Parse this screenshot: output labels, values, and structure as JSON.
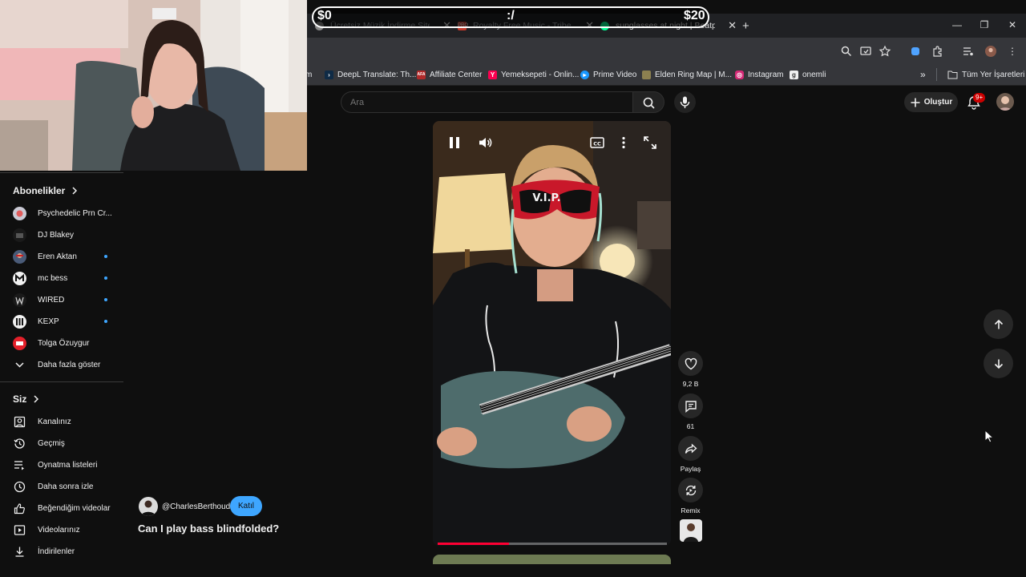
{
  "overlay": {
    "left": "$0",
    "center": ":/",
    "right": "$20"
  },
  "browser": {
    "tabs": [
      {
        "title": "Ücretsiz Müzik İndirme Siteleri",
        "favicon": "music-icon"
      },
      {
        "title": "Royalty Free Music - Tribe of N",
        "favicon": "pro-icon"
      },
      {
        "title": "sunglasses at night | Beatport",
        "favicon": "beatport-icon"
      }
    ],
    "new_tab": "+",
    "bookmarks": [
      {
        "label": "m"
      },
      {
        "label": "DeepL Translate: Th...",
        "icon": "deepl-icon"
      },
      {
        "label": "Affiliate Center",
        "icon": "affiliate-icon"
      },
      {
        "label": "Yemeksepeti - Onlin...",
        "icon": "yemeksepeti-icon"
      },
      {
        "label": "Prime Video",
        "icon": "prime-icon"
      },
      {
        "label": "Elden Ring Map | M...",
        "icon": "map-icon"
      },
      {
        "label": "Instagram",
        "icon": "instagram-icon"
      },
      {
        "label": "onemli",
        "icon": "folder-g-icon"
      }
    ],
    "all_bookmarks": "Tüm Yer İşaretleri"
  },
  "search": {
    "placeholder": "Ara"
  },
  "header": {
    "create_label": "Oluştur",
    "notif_badge": "9+"
  },
  "sidebar": {
    "subscriptions_title": "Abonelikler",
    "subscriptions": [
      {
        "name": "Psychedelic Prn Cr...",
        "color": "#c9c9d4",
        "new": false
      },
      {
        "name": "DJ Blakey",
        "color": "#1a1a1a",
        "new": false
      },
      {
        "name": "Eren Aktan",
        "color": "#4a5b78",
        "new": true
      },
      {
        "name": "mc bess",
        "color": "#f1f1f1",
        "new": true
      },
      {
        "name": "WIRED",
        "color": "#1a1a1a",
        "new": true
      },
      {
        "name": "KEXP",
        "color": "#f1f1f1",
        "new": true
      },
      {
        "name": "Tolga Özuygur",
        "color": "#e3202a",
        "new": false
      }
    ],
    "show_more": "Daha fazla göster",
    "you_title": "Siz",
    "you_items": [
      {
        "label": "Kanalınız",
        "icon": "account-box-icon"
      },
      {
        "label": "Geçmiş",
        "icon": "history-icon"
      },
      {
        "label": "Oynatma listeleri",
        "icon": "playlists-icon"
      },
      {
        "label": "Daha sonra izle",
        "icon": "watch-later-icon"
      },
      {
        "label": "Beğendiğim videolar",
        "icon": "liked-icon"
      },
      {
        "label": "Videolarınız",
        "icon": "your-videos-icon"
      },
      {
        "label": "İndirilenler",
        "icon": "download-icon"
      }
    ]
  },
  "short": {
    "channel": "@CharlesBerthoud",
    "join_label": "Katıl",
    "title": "Can I play bass blindfolded?",
    "goggle_text": "V.I.P.",
    "progress": 0.31,
    "likes": "9,2 B",
    "comments": "61",
    "share_label": "Paylaş",
    "remix_label": "Remix"
  },
  "colors": {
    "accent": "#3ea6ff",
    "progress": "#ff0033",
    "background": "#0f0f0f"
  }
}
